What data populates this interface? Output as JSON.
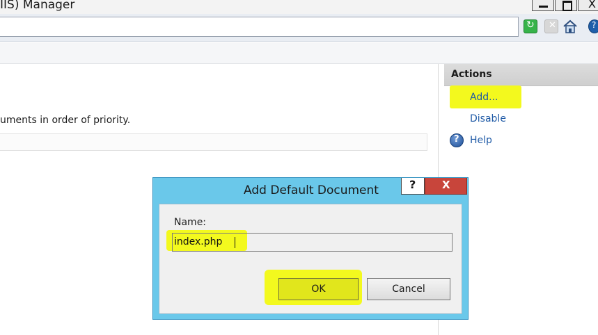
{
  "window": {
    "title": "IIS) Manager",
    "close_glyph": "X"
  },
  "main": {
    "description": "uments in order of priority."
  },
  "actions": {
    "header": "Actions",
    "items": [
      {
        "label": "Add...",
        "highlighted": true
      },
      {
        "label": "Disable"
      },
      {
        "label": "Help",
        "icon": "help-icon"
      }
    ]
  },
  "dialog": {
    "title": "Add Default Document",
    "help_glyph": "?",
    "close_glyph": "X",
    "name_label": "Name:",
    "name_value": "index.php",
    "ok_label": "OK",
    "cancel_label": "Cancel"
  },
  "colors": {
    "highlight": "#f3f91e",
    "dialog_frame": "#6ac8ea",
    "link": "#1f5aa6",
    "close_red": "#c8453b"
  }
}
